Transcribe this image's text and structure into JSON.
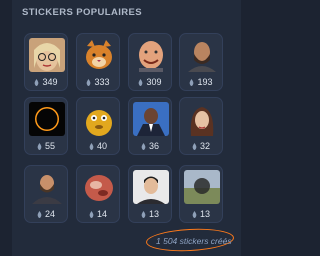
{
  "section_title": "STICKERS POPULAIRES",
  "stickers": [
    {
      "name": "femme-blonde-lunettes",
      "count": "349"
    },
    {
      "name": "chat-roux",
      "count": "333"
    },
    {
      "name": "homme-chauve-souriant",
      "count": "309"
    },
    {
      "name": "homme-barbu-sombre",
      "count": "193"
    },
    {
      "name": "eclipse-solaire",
      "count": "55"
    },
    {
      "name": "personnage-jaune",
      "count": "40"
    },
    {
      "name": "homme-costume-bleu",
      "count": "36"
    },
    {
      "name": "femme-cheveux-bruns",
      "count": "32"
    },
    {
      "name": "homme-barbu-assis",
      "count": "24"
    },
    {
      "name": "visage-flou",
      "count": "14"
    },
    {
      "name": "jeune-homme",
      "count": "13"
    },
    {
      "name": "paysage-brouille",
      "count": "13"
    }
  ],
  "footer_text": "1 504 stickers créés",
  "colors": {
    "annotation_circle": "#ff7a1a",
    "card_bg": "#2a3446",
    "page_bg": "#1c2331"
  }
}
